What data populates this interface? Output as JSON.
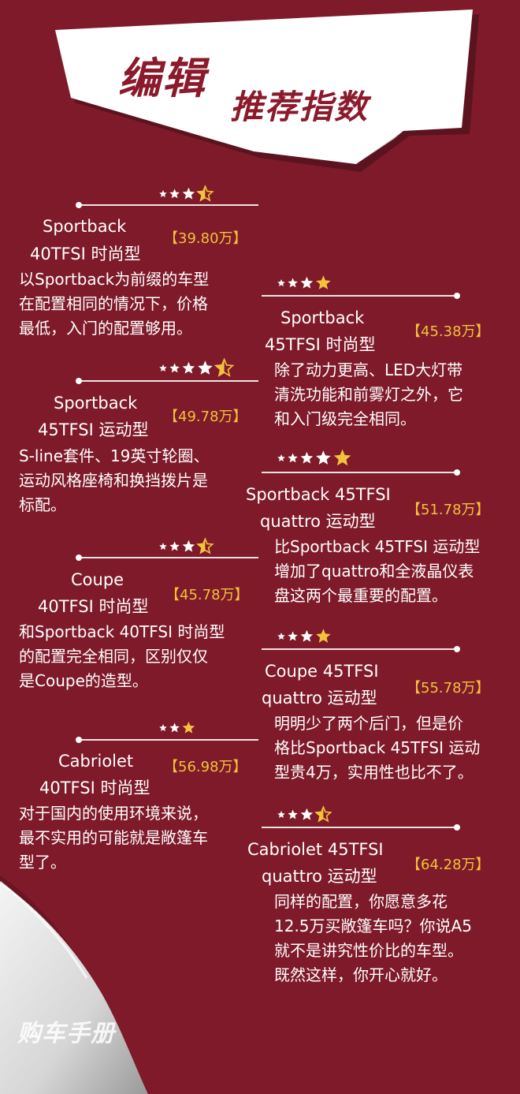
{
  "header": {
    "title_main": "编辑",
    "title_sub": "推荐指数"
  },
  "colors": {
    "background": "#7e1a2a",
    "price": "#f4c23a",
    "star_white": "#ffffff",
    "star_gold": "#f4c23a"
  },
  "trims": [
    {
      "name_line1": "Sportback",
      "name_line2": "40TFSI 时尚型",
      "price": "【39.80万】",
      "rating": 3.5,
      "desc": [
        "以Sportback为前缀的车型",
        "在配置相同的情况下，价格",
        "最低，入门的配置够用。"
      ]
    },
    {
      "name_line1": "Sportback",
      "name_line2": "45TFSI 时尚型",
      "price": "【45.38万】",
      "rating": 4,
      "desc": [
        "除了动力更高、LED大灯带",
        "清洗功能和前雾灯之外，它",
        "和入门级完全相同。"
      ]
    },
    {
      "name_line1": "Sportback",
      "name_line2": "45TFSI 运动型",
      "price": "【49.78万】",
      "rating": 4.5,
      "desc": [
        "S-line套件、19英寸轮圈、",
        "运动风格座椅和换挡拨片是",
        "标配。"
      ]
    },
    {
      "name_line1": "Sportback 45TFSI",
      "name_line2": "quattro 运动型",
      "price": "【51.78万】",
      "rating": 5,
      "desc": [
        "比Sportback 45TFSI 运动型",
        "增加了quattro和全液晶仪表",
        "盘这两个最重要的配置。"
      ]
    },
    {
      "name_line1": "Coupe",
      "name_line2": "40TFSI 时尚型",
      "price": "【45.78万】",
      "rating": 3.5,
      "desc": [
        "和Sportback 40TFSI 时尚型",
        "的配置完全相同，区别仅仅",
        "是Coupe的造型。"
      ]
    },
    {
      "name_line1": "Coupe 45TFSI",
      "name_line2": "quattro 运动型",
      "price": "【55.78万】",
      "rating": 4,
      "desc": [
        "明明少了两个后门，但是价",
        "格比Sportback 45TFSI 运动",
        "型贵4万，实用性也比不了。"
      ]
    },
    {
      "name_line1": "Cabriolet",
      "name_line2": "40TFSI 时尚型",
      "price": "【56.98万】",
      "rating": 3,
      "desc": [
        "对于国内的使用环境来说，",
        "最不实用的可能就是敞篷车",
        "型了。"
      ]
    },
    {
      "name_line1": "Cabriolet 45TFSI",
      "name_line2": "quattro 运动型",
      "price": "【64.28万】",
      "rating": 3.5,
      "desc": [
        "同样的配置，你愿意多花",
        "12.5万买敞篷车吗？你说A5",
        "就不是讲究性价比的车型。",
        "既然这样，你开心就好。"
      ]
    }
  ],
  "watermark": "购车手册"
}
